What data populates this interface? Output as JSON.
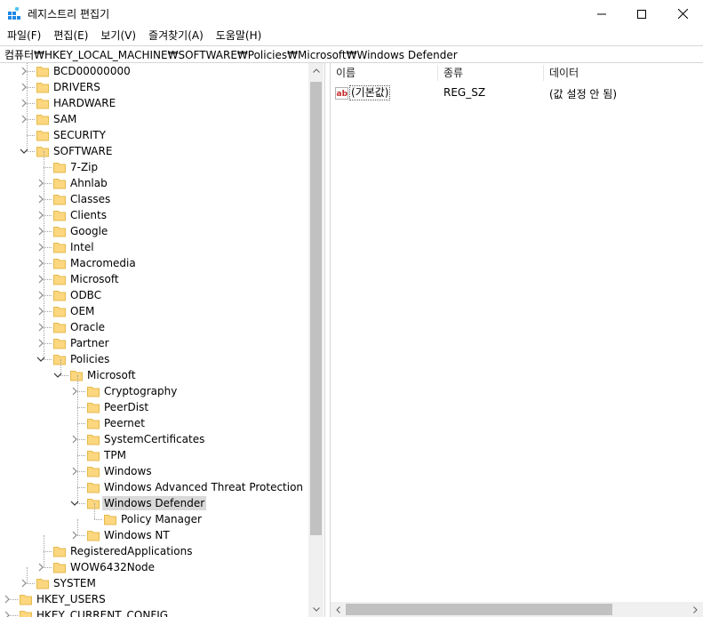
{
  "window": {
    "title": "레지스트리 편집기",
    "controls": [
      "minimize",
      "maximize",
      "close"
    ]
  },
  "menu": {
    "items": [
      "파일(F)",
      "편집(E)",
      "보기(V)",
      "즐겨찾기(A)",
      "도움말(H)"
    ]
  },
  "address": {
    "path": "컴퓨터₩HKEY_LOCAL_MACHINE₩SOFTWARE₩Policies₩Microsoft₩Windows Defender"
  },
  "tree": {
    "items": [
      {
        "label": "BCD00000000",
        "level": 2,
        "expander": "collapsed"
      },
      {
        "label": "DRIVERS",
        "level": 2,
        "expander": "collapsed"
      },
      {
        "label": "HARDWARE",
        "level": 2,
        "expander": "collapsed"
      },
      {
        "label": "SAM",
        "level": 2,
        "expander": "collapsed"
      },
      {
        "label": "SECURITY",
        "level": 2,
        "expander": "none"
      },
      {
        "label": "SOFTWARE",
        "level": 2,
        "expander": "expanded"
      },
      {
        "label": "7-Zip",
        "level": 3,
        "expander": "none"
      },
      {
        "label": "Ahnlab",
        "level": 3,
        "expander": "collapsed"
      },
      {
        "label": "Classes",
        "level": 3,
        "expander": "collapsed"
      },
      {
        "label": "Clients",
        "level": 3,
        "expander": "collapsed"
      },
      {
        "label": "Google",
        "level": 3,
        "expander": "collapsed"
      },
      {
        "label": "Intel",
        "level": 3,
        "expander": "collapsed"
      },
      {
        "label": "Macromedia",
        "level": 3,
        "expander": "collapsed"
      },
      {
        "label": "Microsoft",
        "level": 3,
        "expander": "collapsed"
      },
      {
        "label": "ODBC",
        "level": 3,
        "expander": "collapsed"
      },
      {
        "label": "OEM",
        "level": 3,
        "expander": "collapsed"
      },
      {
        "label": "Oracle",
        "level": 3,
        "expander": "collapsed"
      },
      {
        "label": "Partner",
        "level": 3,
        "expander": "collapsed"
      },
      {
        "label": "Policies",
        "level": 3,
        "expander": "expanded"
      },
      {
        "label": "Microsoft",
        "level": 4,
        "expander": "expanded"
      },
      {
        "label": "Cryptography",
        "level": 5,
        "expander": "collapsed"
      },
      {
        "label": "PeerDist",
        "level": 5,
        "expander": "none"
      },
      {
        "label": "Peernet",
        "level": 5,
        "expander": "none"
      },
      {
        "label": "SystemCertificates",
        "level": 5,
        "expander": "collapsed"
      },
      {
        "label": "TPM",
        "level": 5,
        "expander": "none"
      },
      {
        "label": "Windows",
        "level": 5,
        "expander": "collapsed"
      },
      {
        "label": "Windows Advanced Threat Protection",
        "level": 5,
        "expander": "none"
      },
      {
        "label": "Windows Defender",
        "level": 5,
        "expander": "expanded",
        "selected": true
      },
      {
        "label": "Policy Manager",
        "level": 6,
        "expander": "none"
      },
      {
        "label": "Windows NT",
        "level": 5,
        "expander": "collapsed"
      },
      {
        "label": "RegisteredApplications",
        "level": 3,
        "expander": "none"
      },
      {
        "label": "WOW6432Node",
        "level": 3,
        "expander": "collapsed"
      },
      {
        "label": "SYSTEM",
        "level": 2,
        "expander": "collapsed"
      },
      {
        "label": "HKEY_USERS",
        "level": 1,
        "expander": "collapsed"
      },
      {
        "label": "HKEY_CURRENT_CONFIG",
        "level": 1,
        "expander": "collapsed"
      }
    ]
  },
  "list": {
    "columns": [
      "이름",
      "종류",
      "데이터"
    ],
    "rows": [
      {
        "icon": "string-value-icon",
        "name": "(기본값)",
        "type": "REG_SZ",
        "data": "(값 설정 안 됨)"
      }
    ]
  },
  "scroll": {
    "tree_vertical_position": 0.05,
    "list_horizontal_position": 0.0
  },
  "colors": {
    "folder_fill": "#fcd77f",
    "folder_edge": "#e6b94c",
    "selection": "#d9d9d9",
    "scrollbar_thumb": "#c1c1c1",
    "scrollbar_track": "#f0f0f0"
  }
}
